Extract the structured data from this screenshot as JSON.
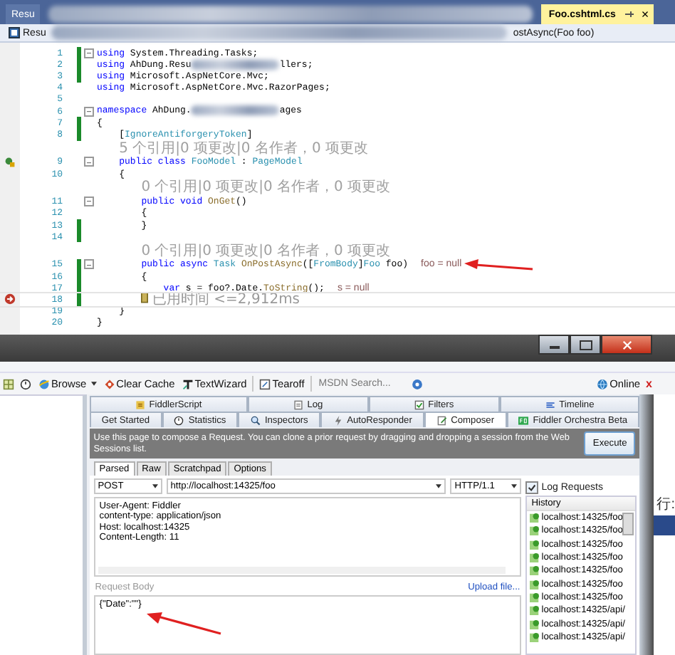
{
  "editor": {
    "tabs": [
      {
        "label": "Resu",
        "selected": false
      },
      {
        "label": "Foo.cshtml.cs",
        "selected": true
      }
    ],
    "tab_close": "×",
    "nav_left": "Resu",
    "nav_right": "ostAsync(Foo foo)",
    "lines": [
      {
        "number": "1",
        "changed": true,
        "fold": true,
        "tokens": [
          {
            "kind": "kw",
            "text": "using"
          },
          {
            "kind": "plain",
            "text": " System.Threading.Tasks;"
          }
        ]
      },
      {
        "number": "2",
        "changed": true,
        "fold": false,
        "tokens": [
          {
            "kind": "kw",
            "text": "using"
          },
          {
            "kind": "plain",
            "text": " AhDung.Resu"
          },
          {
            "kind": "blur"
          },
          {
            "kind": "plain",
            "text": "llers;"
          }
        ]
      },
      {
        "number": "3",
        "changed": true,
        "fold": false,
        "tokens": [
          {
            "kind": "kw",
            "text": "using"
          },
          {
            "kind": "plain",
            "text": " Microsoft.AspNetCore.Mvc;"
          }
        ]
      },
      {
        "number": "4",
        "changed": false,
        "fold": false,
        "tokens": [
          {
            "kind": "kw",
            "text": "using"
          },
          {
            "kind": "plain",
            "text": " Microsoft.AspNetCore.Mvc.RazorPages;"
          }
        ]
      },
      {
        "number": "5",
        "changed": false,
        "fold": false
      },
      {
        "number": "6",
        "changed": false,
        "fold": true,
        "tokens": [
          {
            "kind": "kw",
            "text": "namespace"
          },
          {
            "kind": "plain",
            "text": " AhDung."
          },
          {
            "kind": "blur"
          },
          {
            "kind": "plain",
            "text": "ages"
          }
        ]
      },
      {
        "number": "7",
        "changed": true,
        "fold": false,
        "tokens": [
          {
            "kind": "plain",
            "text": "{"
          }
        ]
      },
      {
        "number": "8",
        "changed": true,
        "fold": false,
        "tokens": [
          {
            "kind": "plain",
            "text": "    ["
          },
          {
            "kind": "type",
            "text": "IgnoreAntiforgeryToken"
          },
          {
            "kind": "plain",
            "text": "]"
          }
        ]
      },
      {
        "number": "9",
        "changed": false,
        "fold": true,
        "quick_action": true,
        "lens": "5 个引用|0 项更改|0 名作者，0 项更改",
        "tokens": [
          {
            "kind": "kw",
            "text": "    public class "
          },
          {
            "kind": "type",
            "text": "FooModel"
          },
          {
            "kind": "plain",
            "text": " : "
          },
          {
            "kind": "type",
            "text": "PageModel"
          }
        ]
      },
      {
        "number": "10",
        "changed": false,
        "fold": false,
        "tokens": [
          {
            "kind": "plain",
            "text": "    {"
          }
        ]
      },
      {
        "number": "11",
        "changed": false,
        "fold": true,
        "lens": "0 个引用|0 项更改|0 名作者，0 项更改",
        "tokens": [
          {
            "kind": "kw",
            "text": "        public void "
          },
          {
            "kind": "method",
            "text": "OnGet"
          },
          {
            "kind": "plain",
            "text": "()"
          }
        ]
      },
      {
        "number": "12",
        "changed": false,
        "fold": false,
        "tokens": [
          {
            "kind": "plain",
            "text": "        {"
          }
        ]
      },
      {
        "number": "13",
        "changed": true,
        "fold": false,
        "tokens": [
          {
            "kind": "plain",
            "text": "        }"
          }
        ]
      },
      {
        "number": "14",
        "changed": true,
        "fold": false
      },
      {
        "number": "15",
        "changed": true,
        "fold": true,
        "lens": "0 个引用|0 项更改|0 名作者，0 项更改",
        "tokens": [
          {
            "kind": "kw",
            "text": "        public async "
          },
          {
            "kind": "type",
            "text": "Task "
          },
          {
            "kind": "method",
            "text": "OnPostAsync"
          },
          {
            "kind": "plain",
            "text": "(["
          },
          {
            "kind": "type",
            "text": "FromBody"
          },
          {
            "kind": "plain",
            "text": "]"
          },
          {
            "kind": "type",
            "text": "Foo"
          },
          {
            "kind": "plain",
            "text": " foo)"
          },
          {
            "kind": "hint",
            "text": "foo = null"
          }
        ]
      },
      {
        "number": "16",
        "changed": true,
        "fold": false,
        "tokens": [
          {
            "kind": "plain",
            "text": "        {"
          }
        ]
      },
      {
        "number": "17",
        "changed": true,
        "fold": false,
        "tokens": [
          {
            "kind": "kw",
            "text": "            var"
          },
          {
            "kind": "plain",
            "text": " s = foo?.Date."
          },
          {
            "kind": "method",
            "text": "ToString"
          },
          {
            "kind": "plain",
            "text": "();"
          },
          {
            "kind": "hint",
            "text": "s = null"
          }
        ]
      },
      {
        "number": "18",
        "changed": true,
        "fold": false,
        "breakpoint": true,
        "tokens": [
          {
            "kind": "perf",
            "text": "已用时间 <=2,912ms"
          }
        ]
      },
      {
        "number": "19",
        "changed": false,
        "fold": false,
        "tokens": [
          {
            "kind": "plain",
            "text": "    }"
          }
        ]
      },
      {
        "number": "20",
        "changed": false,
        "fold": false,
        "tokens": [
          {
            "kind": "plain",
            "text": "}"
          }
        ]
      }
    ]
  },
  "fiddler": {
    "toolbar": [
      {
        "kind": "browse",
        "label": "Browse"
      },
      {
        "kind": "clear",
        "label": "Clear Cache"
      },
      {
        "kind": "wizard",
        "label": "TextWizard"
      },
      {
        "kind": "tearoff",
        "label": "Tearoff"
      }
    ],
    "search": {
      "placeholder": "MSDN Search..."
    },
    "online": "Online",
    "close": "x",
    "tabs_top": [
      {
        "kind": "script",
        "label": "FiddlerScript"
      },
      {
        "kind": "log",
        "label": "Log"
      },
      {
        "kind": "filters",
        "label": "Filters"
      },
      {
        "kind": "timeline",
        "label": "Timeline"
      }
    ],
    "tabs_bottom": [
      {
        "kind": "plain",
        "label": "Get Started",
        "selected": false
      },
      {
        "kind": "stats",
        "label": "Statistics",
        "selected": false
      },
      {
        "kind": "inspect",
        "label": "Inspectors",
        "selected": false
      },
      {
        "kind": "auto",
        "label": "AutoResponder",
        "selected": false
      },
      {
        "kind": "compose",
        "label": "Composer",
        "selected": true
      },
      {
        "kind": "fo",
        "label": "Fiddler Orchestra Beta",
        "selected": false
      }
    ],
    "info": "Use this page to compose a Request. You can clone a prior request by dragging and dropping a session from the Web Sessions list.",
    "execute": "Execute",
    "subtabs": [
      {
        "label": "Parsed",
        "selected": true
      },
      {
        "label": "Raw",
        "selected": false
      },
      {
        "label": "Scratchpad",
        "selected": false
      },
      {
        "label": "Options",
        "selected": false
      }
    ],
    "method": "POST",
    "url": "http://localhost:14325/foo",
    "version": "HTTP/1.1",
    "log_requests": {
      "label": "Log Requests",
      "checked": true
    },
    "headers": [
      "User-Agent: Fiddler",
      "content-type: application/json",
      "Host: localhost:14325",
      "Content-Length: 11"
    ],
    "body_label": "Request Body",
    "upload": "Upload file...",
    "body": "{\"Date\":\"\"}",
    "history_label": "History",
    "history": [
      "localhost:14325/foo",
      "localhost:14325/foo",
      "localhost:14325/foo",
      "localhost:14325/foo",
      "localhost:14325/foo",
      "localhost:14325/foo",
      "localhost:14325/foo",
      "localhost:14325/api/",
      "localhost:14325/api/",
      "localhost:14325/api/"
    ]
  },
  "side_window": {
    "label": "行:"
  }
}
